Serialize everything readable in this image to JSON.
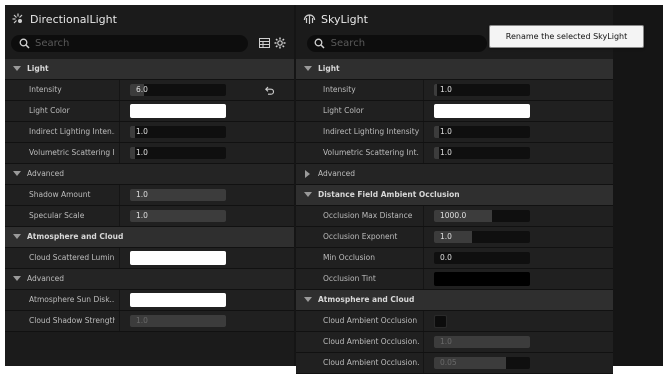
{
  "left": {
    "title": "DirectionalLight",
    "search_placeholder": "Search",
    "rows": [
      {
        "kind": "cat",
        "label": "Light"
      },
      {
        "kind": "num",
        "label": "Intensity",
        "value": "6.0",
        "fill": 0.15,
        "reset": true
      },
      {
        "kind": "color",
        "label": "Light Color",
        "color": "#ffffff"
      },
      {
        "kind": "num",
        "label": "Indirect Lighting Inten...",
        "value": "1.0",
        "fill": 0.05
      },
      {
        "kind": "num",
        "label": "Volumetric Scattering I...",
        "value": "1.0",
        "fill": 0.05
      },
      {
        "kind": "sub",
        "label": "Advanced",
        "arrow": "down"
      },
      {
        "kind": "num",
        "label": "Shadow Amount",
        "value": "1.0",
        "fill": 1.0
      },
      {
        "kind": "num",
        "label": "Specular Scale",
        "value": "1.0",
        "fill": 1.0
      },
      {
        "kind": "cat",
        "label": "Atmosphere and Cloud"
      },
      {
        "kind": "color",
        "label": "Cloud Scattered Lumin...",
        "color": "#ffffff"
      },
      {
        "kind": "sub",
        "label": "Advanced",
        "arrow": "down"
      },
      {
        "kind": "color",
        "label": "Atmosphere Sun Disk...",
        "color": "#ffffff"
      },
      {
        "kind": "num",
        "label": "Cloud Shadow Strength",
        "value": "1.0",
        "fill": 1.0,
        "dim": true
      }
    ]
  },
  "right": {
    "title": "SkyLight",
    "search_placeholder": "Search",
    "rows": [
      {
        "kind": "cat",
        "label": "Light"
      },
      {
        "kind": "num",
        "label": "Intensity",
        "value": "1.0",
        "fill": 0.03
      },
      {
        "kind": "color",
        "label": "Light Color",
        "color": "#ffffff"
      },
      {
        "kind": "num",
        "label": "Indirect Lighting Intensity",
        "value": "1.0",
        "fill": 0.05
      },
      {
        "kind": "num",
        "label": "Volumetric Scattering Int...",
        "value": "1.0",
        "fill": 0.05
      },
      {
        "kind": "sub",
        "label": "Advanced",
        "arrow": "right"
      },
      {
        "kind": "cat",
        "label": "Distance Field Ambient Occlusion"
      },
      {
        "kind": "num",
        "label": "Occlusion Max Distance",
        "value": "1000.0",
        "fill": 0.6
      },
      {
        "kind": "num",
        "label": "Occlusion Exponent",
        "value": "1.0",
        "fill": 0.4
      },
      {
        "kind": "num",
        "label": "Min Occlusion",
        "value": "0.0",
        "fill": 0.0
      },
      {
        "kind": "color",
        "label": "Occlusion Tint",
        "color": "#000000"
      },
      {
        "kind": "cat",
        "label": "Atmosphere and Cloud"
      },
      {
        "kind": "check",
        "label": "Cloud Ambient Occlusion"
      },
      {
        "kind": "num",
        "label": "Cloud Ambient Occlusion...",
        "value": "1.0",
        "fill": 1.0,
        "dim": true
      },
      {
        "kind": "num",
        "label": "Cloud Ambient Occlusion...",
        "value": "0.05",
        "fill": 0.75,
        "dim": true
      }
    ]
  },
  "tooltip": "Rename the selected SkyLight",
  "icons": {
    "left_title": "directional-light-icon",
    "right_title": "sky-light-icon",
    "search": "search-icon",
    "table": "table-view-icon",
    "settings": "gear-icon",
    "reset": "reset-arrow-icon"
  }
}
